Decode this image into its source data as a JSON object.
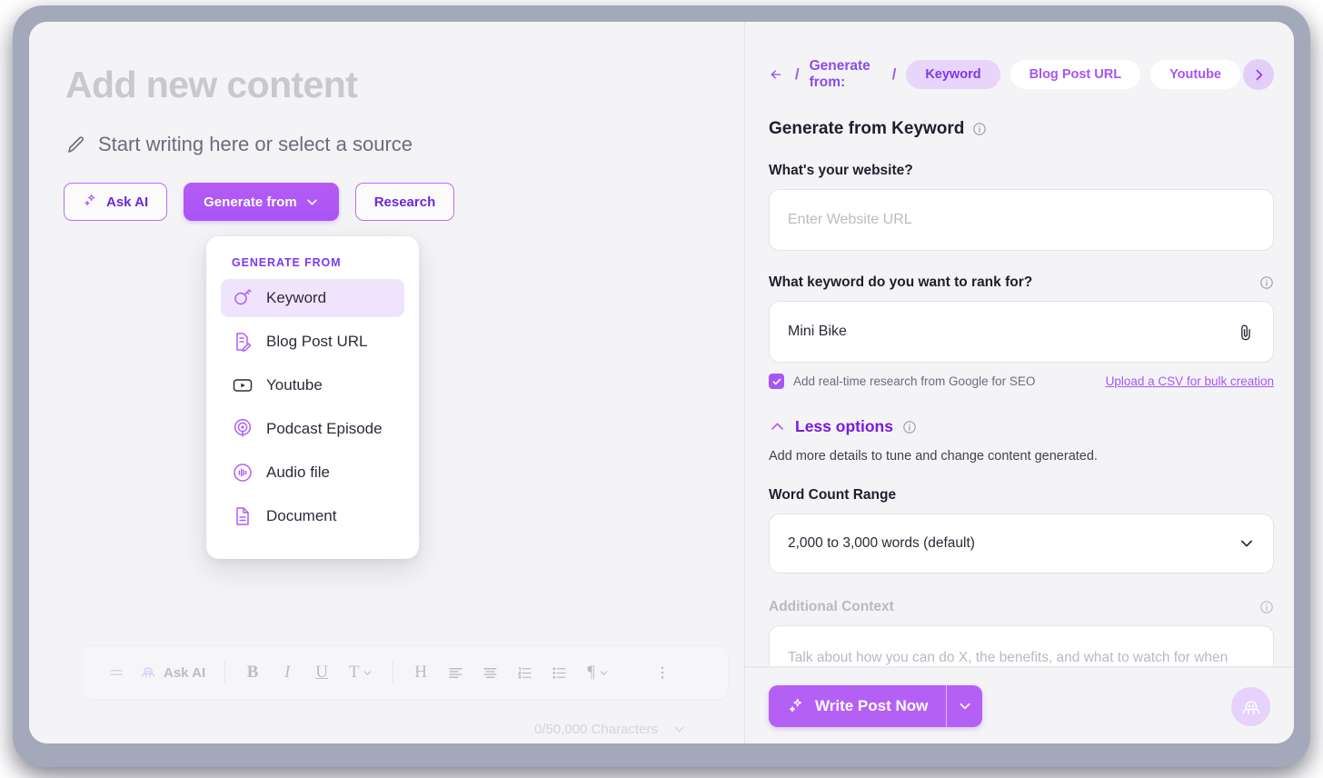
{
  "left": {
    "title": "Add new content",
    "subtitle": "Start writing here or select a source",
    "buttons": {
      "ask_ai": "Ask AI",
      "generate_from": "Generate from",
      "research": "Research"
    },
    "dropdown": {
      "header": "GENERATE FROM",
      "items": [
        {
          "label": "Keyword",
          "icon": "keyword-icon",
          "selected": true
        },
        {
          "label": "Blog Post URL",
          "icon": "blog-post-icon",
          "selected": false
        },
        {
          "label": "Youtube",
          "icon": "youtube-icon",
          "selected": false
        },
        {
          "label": "Podcast Episode",
          "icon": "podcast-icon",
          "selected": false
        },
        {
          "label": "Audio file",
          "icon": "audio-file-icon",
          "selected": false
        },
        {
          "label": "Document",
          "icon": "document-icon",
          "selected": false
        }
      ]
    },
    "toolbar": {
      "ask_ai": "Ask AI",
      "bold": "B",
      "italic": "I",
      "underline": "U",
      "font": "T",
      "heading": "H",
      "align_left": "align-left",
      "align_center": "align-center",
      "ordered_list": "ordered-list",
      "bullet_list": "bullet-list",
      "paragraph": "¶",
      "more": "more-options"
    },
    "character_count": "0/50,000 Characters"
  },
  "right": {
    "breadcrumb": {
      "label": "Generate from:",
      "separator": "/",
      "chips": [
        {
          "label": "Keyword",
          "selected": true
        },
        {
          "label": "Blog Post URL",
          "selected": false
        },
        {
          "label": "Youtube",
          "selected": false
        }
      ]
    },
    "section_title": "Generate from Keyword",
    "website": {
      "label": "What's your website?",
      "placeholder": "Enter Website URL",
      "value": ""
    },
    "keyword": {
      "label": "What keyword do you want to rank for?",
      "value": "Mini Bike"
    },
    "checkbox_label": "Add real-time research from Google for SEO",
    "csv_link": "Upload a CSV for bulk creation",
    "less_options": {
      "label": "Less options",
      "description": "Add more details to tune and change content generated."
    },
    "word_count": {
      "label": "Word Count Range",
      "value": "2,000 to 3,000 words (default)"
    },
    "additional_context": {
      "label": "Additional Context",
      "placeholder": "Talk about how you can do X, the benefits, and what to watch for when doing Y"
    },
    "cta": {
      "label": "Write Post Now"
    }
  },
  "colors": {
    "accent": "#a855f7",
    "accent_dark": "#7c3aed",
    "chip_selected_bg": "#e9d4fb",
    "panel_bg": "#f4f4f6",
    "frame": "#a3a8bb"
  }
}
